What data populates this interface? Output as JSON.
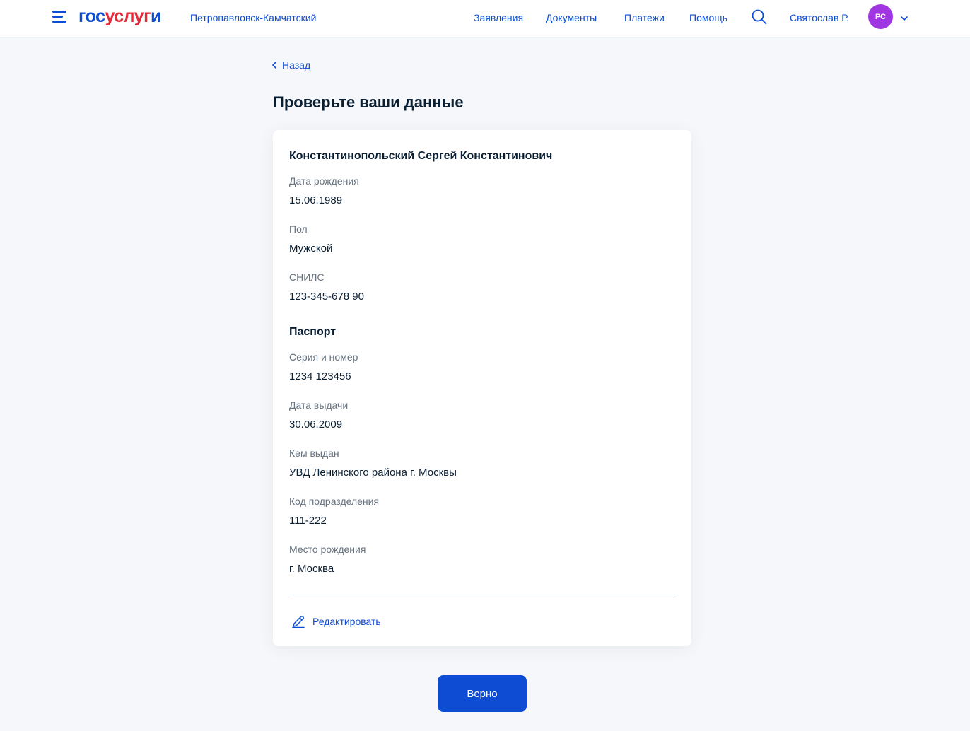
{
  "header": {
    "logo": {
      "part1": "гос",
      "part2": "услуг",
      "part3": "и"
    },
    "city": "Петропавловск-Камчатский",
    "nav": [
      "Заявления",
      "Документы",
      "Платежи",
      "Помощь"
    ],
    "user_name": "Святослав Р.",
    "avatar_initials": "РС",
    "icons": {
      "menu": "burger-menu-icon",
      "search": "search-icon",
      "dropdown": "chevron-down-icon"
    }
  },
  "back_label": "Назад",
  "page_title": "Проверьте ваши данные",
  "card": {
    "person_name": "Константинопольский Сергей Константинович",
    "personal_fields": [
      {
        "label": "Дата рождения",
        "value": "15.06.1989"
      },
      {
        "label": "Пол",
        "value": "Мужской"
      },
      {
        "label": "СНИЛС",
        "value": "123-345-678 90"
      }
    ],
    "passport_title": "Паспорт",
    "passport_fields": [
      {
        "label": "Серия и номер",
        "value": "1234 123456"
      },
      {
        "label": "Дата выдачи",
        "value": "30.06.2009"
      },
      {
        "label": "Кем выдан",
        "value": "УВД Ленинского района г. Москвы"
      },
      {
        "label": "Код подразделения",
        "value": "111-222"
      },
      {
        "label": "Место рождения",
        "value": "г. Москва"
      }
    ],
    "edit_label": "Редактировать"
  },
  "confirm_label": "Верно",
  "colors": {
    "accent": "#0d4cd3",
    "logo_red": "#e52a3a",
    "avatar": "#9f36e2",
    "background": "#f5f7fa",
    "text": "#0b1f33",
    "muted": "#66727f"
  }
}
